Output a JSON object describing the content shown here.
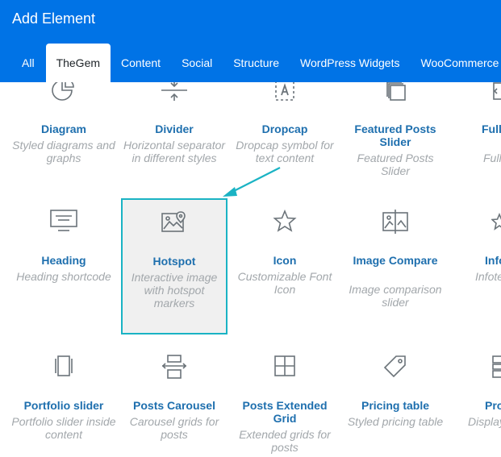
{
  "window": {
    "title": "Add Element"
  },
  "tabs": [
    {
      "label": "All"
    },
    {
      "label": "TheGem"
    },
    {
      "label": "Content"
    },
    {
      "label": "Social"
    },
    {
      "label": "Structure"
    },
    {
      "label": "WordPress Widgets"
    },
    {
      "label": "WooCommerce"
    }
  ],
  "elements": {
    "diagram": {
      "name": "Diagram",
      "desc": "Styled diagrams and graphs",
      "icon": "pie-chart-icon"
    },
    "divider": {
      "name": "Divider",
      "desc": "Horizontal separator in different styles",
      "icon": "divider-icon"
    },
    "dropcap": {
      "name": "Dropcap",
      "desc": "Dropcap symbol for text content",
      "icon": "dropcap-icon"
    },
    "featured_posts_slider": {
      "name": "Featured Posts Slider",
      "desc": "Featured Posts Slider",
      "icon": "layers-icon"
    },
    "fullwidth_content": {
      "name": "Full Cont",
      "desc": "Full",
      "icon": "fullwidth-icon"
    },
    "heading": {
      "name": "Heading",
      "desc": "Heading shortcode",
      "icon": "heading-icon"
    },
    "hotspot": {
      "name": "Hotspot",
      "desc": "Interactive image with hotspot markers",
      "icon": "image-pin-icon"
    },
    "icon": {
      "name": "Icon",
      "desc": "Customizable Font Icon",
      "icon": "star-icon"
    },
    "image_compare": {
      "name": "Image Compare",
      "desc": "Image comparison slider",
      "icon": "image-compare-icon"
    },
    "infobox": {
      "name": "Info",
      "desc": "Infote Ic",
      "icon": "star-small-icon"
    },
    "portfolio_slider": {
      "name": "Portfolio slider",
      "desc": "Portfolio slider inside content",
      "icon": "portfolio-slider-icon"
    },
    "posts_carousel": {
      "name": "Posts Carousel",
      "desc": "Carousel grids for posts",
      "icon": "carousel-icon"
    },
    "posts_extended_grid": {
      "name": "Posts Extended Grid",
      "desc": "Extended grids for posts",
      "icon": "grid-icon"
    },
    "pricing_table": {
      "name": "Pricing table",
      "desc": "Styled pricing table",
      "icon": "price-tag-icon"
    },
    "product_categories": {
      "name": "Pro Categori",
      "desc": "Display categ",
      "icon": "product-categories-icon"
    }
  },
  "colors": {
    "header": "#0073e6",
    "link": "#1e6fae",
    "muted": "#a2a7ab",
    "highlight": "#1ab3c4"
  }
}
